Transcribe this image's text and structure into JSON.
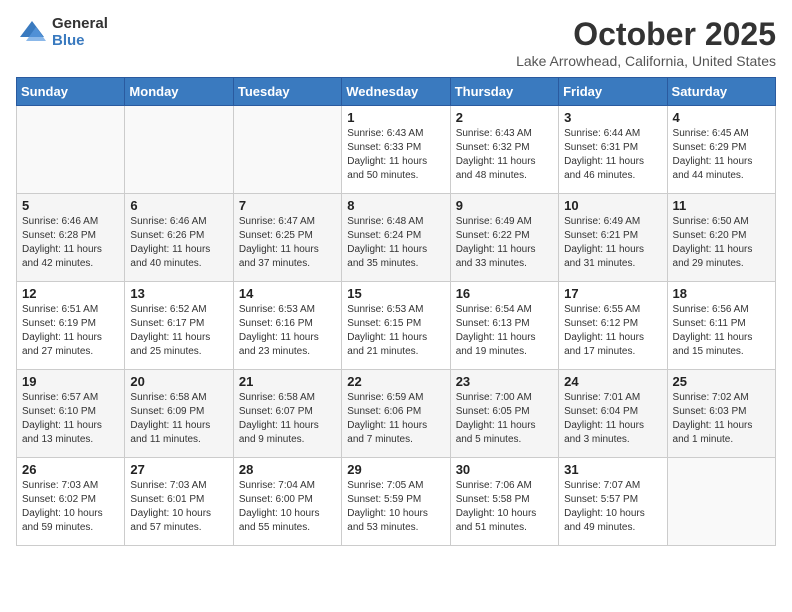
{
  "logo": {
    "general": "General",
    "blue": "Blue"
  },
  "title": "October 2025",
  "location": "Lake Arrowhead, California, United States",
  "weekdays": [
    "Sunday",
    "Monday",
    "Tuesday",
    "Wednesday",
    "Thursday",
    "Friday",
    "Saturday"
  ],
  "weeks": [
    [
      {
        "day": "",
        "info": ""
      },
      {
        "day": "",
        "info": ""
      },
      {
        "day": "",
        "info": ""
      },
      {
        "day": "1",
        "info": "Sunrise: 6:43 AM\nSunset: 6:33 PM\nDaylight: 11 hours\nand 50 minutes."
      },
      {
        "day": "2",
        "info": "Sunrise: 6:43 AM\nSunset: 6:32 PM\nDaylight: 11 hours\nand 48 minutes."
      },
      {
        "day": "3",
        "info": "Sunrise: 6:44 AM\nSunset: 6:31 PM\nDaylight: 11 hours\nand 46 minutes."
      },
      {
        "day": "4",
        "info": "Sunrise: 6:45 AM\nSunset: 6:29 PM\nDaylight: 11 hours\nand 44 minutes."
      }
    ],
    [
      {
        "day": "5",
        "info": "Sunrise: 6:46 AM\nSunset: 6:28 PM\nDaylight: 11 hours\nand 42 minutes."
      },
      {
        "day": "6",
        "info": "Sunrise: 6:46 AM\nSunset: 6:26 PM\nDaylight: 11 hours\nand 40 minutes."
      },
      {
        "day": "7",
        "info": "Sunrise: 6:47 AM\nSunset: 6:25 PM\nDaylight: 11 hours\nand 37 minutes."
      },
      {
        "day": "8",
        "info": "Sunrise: 6:48 AM\nSunset: 6:24 PM\nDaylight: 11 hours\nand 35 minutes."
      },
      {
        "day": "9",
        "info": "Sunrise: 6:49 AM\nSunset: 6:22 PM\nDaylight: 11 hours\nand 33 minutes."
      },
      {
        "day": "10",
        "info": "Sunrise: 6:49 AM\nSunset: 6:21 PM\nDaylight: 11 hours\nand 31 minutes."
      },
      {
        "day": "11",
        "info": "Sunrise: 6:50 AM\nSunset: 6:20 PM\nDaylight: 11 hours\nand 29 minutes."
      }
    ],
    [
      {
        "day": "12",
        "info": "Sunrise: 6:51 AM\nSunset: 6:19 PM\nDaylight: 11 hours\nand 27 minutes."
      },
      {
        "day": "13",
        "info": "Sunrise: 6:52 AM\nSunset: 6:17 PM\nDaylight: 11 hours\nand 25 minutes."
      },
      {
        "day": "14",
        "info": "Sunrise: 6:53 AM\nSunset: 6:16 PM\nDaylight: 11 hours\nand 23 minutes."
      },
      {
        "day": "15",
        "info": "Sunrise: 6:53 AM\nSunset: 6:15 PM\nDaylight: 11 hours\nand 21 minutes."
      },
      {
        "day": "16",
        "info": "Sunrise: 6:54 AM\nSunset: 6:13 PM\nDaylight: 11 hours\nand 19 minutes."
      },
      {
        "day": "17",
        "info": "Sunrise: 6:55 AM\nSunset: 6:12 PM\nDaylight: 11 hours\nand 17 minutes."
      },
      {
        "day": "18",
        "info": "Sunrise: 6:56 AM\nSunset: 6:11 PM\nDaylight: 11 hours\nand 15 minutes."
      }
    ],
    [
      {
        "day": "19",
        "info": "Sunrise: 6:57 AM\nSunset: 6:10 PM\nDaylight: 11 hours\nand 13 minutes."
      },
      {
        "day": "20",
        "info": "Sunrise: 6:58 AM\nSunset: 6:09 PM\nDaylight: 11 hours\nand 11 minutes."
      },
      {
        "day": "21",
        "info": "Sunrise: 6:58 AM\nSunset: 6:07 PM\nDaylight: 11 hours\nand 9 minutes."
      },
      {
        "day": "22",
        "info": "Sunrise: 6:59 AM\nSunset: 6:06 PM\nDaylight: 11 hours\nand 7 minutes."
      },
      {
        "day": "23",
        "info": "Sunrise: 7:00 AM\nSunset: 6:05 PM\nDaylight: 11 hours\nand 5 minutes."
      },
      {
        "day": "24",
        "info": "Sunrise: 7:01 AM\nSunset: 6:04 PM\nDaylight: 11 hours\nand 3 minutes."
      },
      {
        "day": "25",
        "info": "Sunrise: 7:02 AM\nSunset: 6:03 PM\nDaylight: 11 hours\nand 1 minute."
      }
    ],
    [
      {
        "day": "26",
        "info": "Sunrise: 7:03 AM\nSunset: 6:02 PM\nDaylight: 10 hours\nand 59 minutes."
      },
      {
        "day": "27",
        "info": "Sunrise: 7:03 AM\nSunset: 6:01 PM\nDaylight: 10 hours\nand 57 minutes."
      },
      {
        "day": "28",
        "info": "Sunrise: 7:04 AM\nSunset: 6:00 PM\nDaylight: 10 hours\nand 55 minutes."
      },
      {
        "day": "29",
        "info": "Sunrise: 7:05 AM\nSunset: 5:59 PM\nDaylight: 10 hours\nand 53 minutes."
      },
      {
        "day": "30",
        "info": "Sunrise: 7:06 AM\nSunset: 5:58 PM\nDaylight: 10 hours\nand 51 minutes."
      },
      {
        "day": "31",
        "info": "Sunrise: 7:07 AM\nSunset: 5:57 PM\nDaylight: 10 hours\nand 49 minutes."
      },
      {
        "day": "",
        "info": ""
      }
    ]
  ]
}
